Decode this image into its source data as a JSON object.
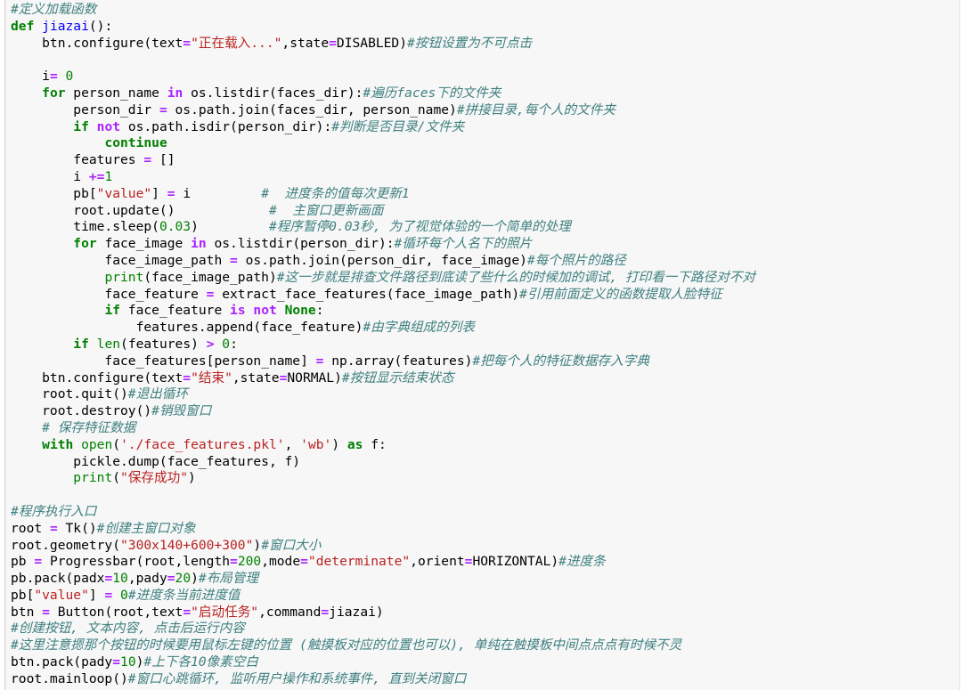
{
  "colors": {
    "background": "#ffffff",
    "cell_background": "#f7f7f7",
    "keyword": "#008000",
    "function_name": "#0000ff",
    "string": "#ba2121",
    "number": "#008000",
    "operator": "#aa22ff",
    "builtin": "#008000",
    "comment": "#408080",
    "text": "#000000"
  },
  "code_lines": [
    [
      [
        "com",
        "#定义加载函数"
      ]
    ],
    [
      [
        "kw",
        "def"
      ],
      [
        "txt",
        " "
      ],
      [
        "fn",
        "jiazai"
      ],
      [
        "txt",
        "():"
      ]
    ],
    [
      [
        "txt",
        "    btn.configure(text"
      ],
      [
        "op",
        "="
      ],
      [
        "str",
        "\"正在载入...\""
      ],
      [
        "txt",
        ",state"
      ],
      [
        "op",
        "="
      ],
      [
        "txt",
        "DISABLED)"
      ],
      [
        "com",
        "#按钮设置为不可点击"
      ]
    ],
    [],
    [
      [
        "txt",
        "    i"
      ],
      [
        "op",
        "="
      ],
      [
        "txt",
        " "
      ],
      [
        "num",
        "0"
      ]
    ],
    [
      [
        "txt",
        "    "
      ],
      [
        "kw",
        "for"
      ],
      [
        "txt",
        " person_name "
      ],
      [
        "op",
        "in"
      ],
      [
        "txt",
        " os.listdir(faces_dir):"
      ],
      [
        "com",
        "#遍历faces下的文件夹"
      ]
    ],
    [
      [
        "txt",
        "        person_dir "
      ],
      [
        "op",
        "="
      ],
      [
        "txt",
        " os.path.join(faces_dir, person_name)"
      ],
      [
        "com",
        "#拼接目录,每个人的文件夹"
      ]
    ],
    [
      [
        "txt",
        "        "
      ],
      [
        "kw",
        "if"
      ],
      [
        "txt",
        " "
      ],
      [
        "op",
        "not"
      ],
      [
        "txt",
        " os.path.isdir(person_dir):"
      ],
      [
        "com",
        "#判断是否目录/文件夹"
      ]
    ],
    [
      [
        "txt",
        "            "
      ],
      [
        "kw",
        "continue"
      ]
    ],
    [
      [
        "txt",
        "        features "
      ],
      [
        "op",
        "="
      ],
      [
        "txt",
        " []"
      ]
    ],
    [
      [
        "txt",
        "        i "
      ],
      [
        "op",
        "+="
      ],
      [
        "num",
        "1"
      ]
    ],
    [
      [
        "txt",
        "        pb["
      ],
      [
        "str",
        "\"value\""
      ],
      [
        "txt",
        "] "
      ],
      [
        "op",
        "="
      ],
      [
        "txt",
        " i         "
      ],
      [
        "com",
        "#  进度条的值每次更新1"
      ]
    ],
    [
      [
        "txt",
        "        root.update()            "
      ],
      [
        "com",
        "#  主窗口更新画面"
      ]
    ],
    [
      [
        "txt",
        "        time.sleep("
      ],
      [
        "num",
        "0.03"
      ],
      [
        "txt",
        ")         "
      ],
      [
        "com",
        "#程序暂停0.03秒, 为了视觉体验的一个简单的处理"
      ]
    ],
    [
      [
        "txt",
        "        "
      ],
      [
        "kw",
        "for"
      ],
      [
        "txt",
        " face_image "
      ],
      [
        "op",
        "in"
      ],
      [
        "txt",
        " os.listdir(person_dir):"
      ],
      [
        "com",
        "#循环每个人名下的照片"
      ]
    ],
    [
      [
        "txt",
        "            face_image_path "
      ],
      [
        "op",
        "="
      ],
      [
        "txt",
        " os.path.join(person_dir, face_image)"
      ],
      [
        "com",
        "#每个照片的路径"
      ]
    ],
    [
      [
        "txt",
        "            "
      ],
      [
        "bi",
        "print"
      ],
      [
        "txt",
        "(face_image_path)"
      ],
      [
        "com",
        "#这一步就是排查文件路径到底读了些什么的时候加的调试, 打印看一下路径对不对"
      ]
    ],
    [
      [
        "txt",
        "            face_feature "
      ],
      [
        "op",
        "="
      ],
      [
        "txt",
        " extract_face_features(face_image_path)"
      ],
      [
        "com",
        "#引用前面定义的函数提取人脸特征"
      ]
    ],
    [
      [
        "txt",
        "            "
      ],
      [
        "kw",
        "if"
      ],
      [
        "txt",
        " face_feature "
      ],
      [
        "op",
        "is"
      ],
      [
        "txt",
        " "
      ],
      [
        "op",
        "not"
      ],
      [
        "txt",
        " "
      ],
      [
        "kw",
        "None"
      ],
      [
        "txt",
        ":"
      ]
    ],
    [
      [
        "txt",
        "                features.append(face_feature)"
      ],
      [
        "com",
        "#由字典组成的列表"
      ]
    ],
    [
      [
        "txt",
        "        "
      ],
      [
        "kw",
        "if"
      ],
      [
        "txt",
        " "
      ],
      [
        "bi",
        "len"
      ],
      [
        "txt",
        "(features) "
      ],
      [
        "op",
        ">"
      ],
      [
        "txt",
        " "
      ],
      [
        "num",
        "0"
      ],
      [
        "txt",
        ":"
      ]
    ],
    [
      [
        "txt",
        "            face_features[person_name] "
      ],
      [
        "op",
        "="
      ],
      [
        "txt",
        " np.array(features)"
      ],
      [
        "com",
        "#把每个人的特征数据存入字典"
      ]
    ],
    [
      [
        "txt",
        "    btn.configure(text"
      ],
      [
        "op",
        "="
      ],
      [
        "str",
        "\"结束\""
      ],
      [
        "txt",
        ",state"
      ],
      [
        "op",
        "="
      ],
      [
        "txt",
        "NORMAL)"
      ],
      [
        "com",
        "#按钮显示结束状态"
      ]
    ],
    [
      [
        "txt",
        "    root.quit()"
      ],
      [
        "com",
        "#退出循环"
      ]
    ],
    [
      [
        "txt",
        "    root.destroy()"
      ],
      [
        "com",
        "#销毁窗口"
      ]
    ],
    [
      [
        "txt",
        "    "
      ],
      [
        "com",
        "# 保存特征数据"
      ]
    ],
    [
      [
        "txt",
        "    "
      ],
      [
        "kw",
        "with"
      ],
      [
        "txt",
        " "
      ],
      [
        "bi",
        "open"
      ],
      [
        "txt",
        "("
      ],
      [
        "str",
        "'./face_features.pkl'"
      ],
      [
        "txt",
        ", "
      ],
      [
        "str",
        "'wb'"
      ],
      [
        "txt",
        ") "
      ],
      [
        "kw",
        "as"
      ],
      [
        "txt",
        " f:"
      ]
    ],
    [
      [
        "txt",
        "        pickle.dump(face_features, f)"
      ]
    ],
    [
      [
        "txt",
        "        "
      ],
      [
        "bi",
        "print"
      ],
      [
        "txt",
        "("
      ],
      [
        "str",
        "\"保存成功\""
      ],
      [
        "txt",
        ")"
      ]
    ],
    [],
    [
      [
        "com",
        "#程序执行入口"
      ]
    ],
    [
      [
        "txt",
        "root "
      ],
      [
        "op",
        "="
      ],
      [
        "txt",
        " Tk()"
      ],
      [
        "com",
        "#创建主窗口对象"
      ]
    ],
    [
      [
        "txt",
        "root.geometry("
      ],
      [
        "str",
        "\"300x140+600+300\""
      ],
      [
        "txt",
        ")"
      ],
      [
        "com",
        "#窗口大小"
      ]
    ],
    [
      [
        "txt",
        "pb "
      ],
      [
        "op",
        "="
      ],
      [
        "txt",
        " Progressbar(root,length"
      ],
      [
        "op",
        "="
      ],
      [
        "num",
        "200"
      ],
      [
        "txt",
        ",mode"
      ],
      [
        "op",
        "="
      ],
      [
        "str",
        "\"determinate\""
      ],
      [
        "txt",
        ",orient"
      ],
      [
        "op",
        "="
      ],
      [
        "txt",
        "HORIZONTAL)"
      ],
      [
        "com",
        "#进度条"
      ]
    ],
    [
      [
        "txt",
        "pb.pack(padx"
      ],
      [
        "op",
        "="
      ],
      [
        "num",
        "10"
      ],
      [
        "txt",
        ",pady"
      ],
      [
        "op",
        "="
      ],
      [
        "num",
        "20"
      ],
      [
        "txt",
        ")"
      ],
      [
        "com",
        "#布局管理"
      ]
    ],
    [
      [
        "txt",
        "pb["
      ],
      [
        "str",
        "\"value\""
      ],
      [
        "txt",
        "] "
      ],
      [
        "op",
        "="
      ],
      [
        "txt",
        " "
      ],
      [
        "num",
        "0"
      ],
      [
        "com",
        "#进度条当前进度值"
      ]
    ],
    [
      [
        "txt",
        "btn "
      ],
      [
        "op",
        "="
      ],
      [
        "txt",
        " Button(root,text"
      ],
      [
        "op",
        "="
      ],
      [
        "str",
        "\"启动任务\""
      ],
      [
        "txt",
        ",command"
      ],
      [
        "op",
        "="
      ],
      [
        "txt",
        "jiazai)"
      ]
    ],
    [
      [
        "com",
        "#创建按钮, 文本内容, 点击后运行内容"
      ]
    ],
    [
      [
        "com",
        "#这里注意摁那个按钮的时候要用鼠标左键的位置 (触摸板对应的位置也可以), 单纯在触摸板中间点点点有时候不灵"
      ]
    ],
    [
      [
        "txt",
        "btn.pack(pady"
      ],
      [
        "op",
        "="
      ],
      [
        "num",
        "10"
      ],
      [
        "txt",
        ")"
      ],
      [
        "com",
        "#上下各10像素空白"
      ]
    ],
    [
      [
        "txt",
        "root.mainloop()"
      ],
      [
        "com",
        "#窗口心跳循环, 监听用户操作和系统事件, 直到关闭窗口"
      ]
    ]
  ]
}
